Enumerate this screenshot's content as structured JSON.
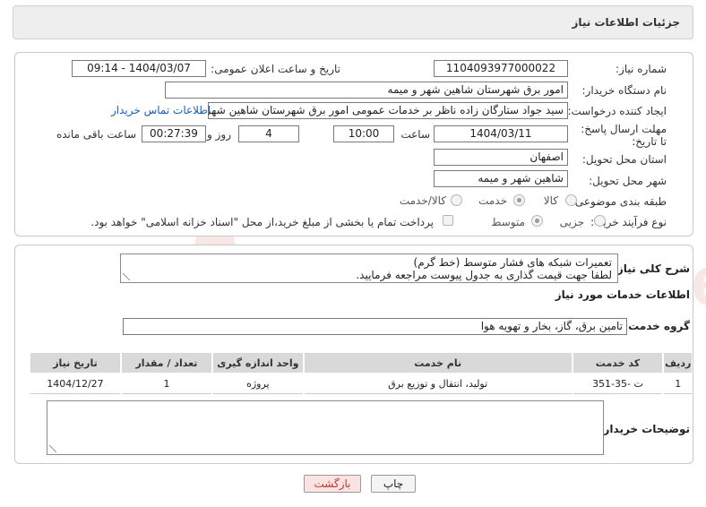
{
  "header": {
    "title": "جزئیات اطلاعات نیاز"
  },
  "fields": {
    "need_number_label": "شماره نیاز:",
    "need_number": "1104093977000022",
    "announce_label": "تاریخ و ساعت اعلان عمومی:",
    "announce_value": "1404/03/07 - 09:14",
    "buyer_org_label": "نام دستگاه خریدار:",
    "buyer_org": "امور برق شهرستان شاهین شهر و میمه",
    "creator_label": "ایجاد کننده درخواست:",
    "creator": "سید جواد ستارگان زاده ناظر بر خدمات عمومی امور برق شهرستان شاهین شهر",
    "contact_link": "اطلاعات تماس خریدار",
    "deadline_label": "مهلت ارسال پاسخ: تا تاریخ:",
    "deadline_date": "1404/03/11",
    "hour_label": "ساعت",
    "deadline_time": "10:00",
    "days_value": "4",
    "days_label": "روز و",
    "remaining_value": "00:27:39",
    "remaining_label": "ساعت باقی مانده",
    "province_label": "استان محل تحویل:",
    "province": "اصفهان",
    "city_label": "شهر محل تحویل:",
    "city": "شاهین شهر و میمه",
    "category_label": "طبقه بندی موضوعی:",
    "category_options": [
      "کالا",
      "خدمت",
      "کالا/خدمت"
    ],
    "category_selected": "خدمت",
    "process_label": "نوع فرآیند خرید :",
    "process_options": [
      "جزیی",
      "متوسط"
    ],
    "process_selected": "متوسط",
    "payment_note": "پرداخت تمام یا بخشی از مبلغ خرید،از محل \"اسناد خزانه اسلامی\" خواهد بود."
  },
  "description": {
    "label": "شرح کلی نیاز:",
    "line1": "تعمیرات شبکه های فشار متوسط (خط گرم)",
    "line2": "لطفا جهت قیمت گذاری به جدول پیوست مراجعه فرمایید."
  },
  "services": {
    "section_title": "اطلاعات خدمات مورد نیاز",
    "group_label": "گروه خدمت:",
    "group_value": "تامین برق، گاز، بخار و تهویه هوا",
    "columns": [
      "ردیف",
      "کد خدمت",
      "نام خدمت",
      "واحد اندازه گیری",
      "تعداد / مقدار",
      "تاریخ نیاز"
    ],
    "rows": [
      [
        "1",
        "ت -35-351",
        "تولید، انتقال و توزیع برق",
        "پروژه",
        "1",
        "1404/12/27"
      ]
    ]
  },
  "buyer_notes": {
    "label": "توضیحات خریدار:",
    "value": ""
  },
  "buttons": {
    "print": "چاپ",
    "back": "بازگشت"
  },
  "watermark": {
    "text": "AriaTender.neT"
  },
  "colors": {
    "link": "#1a5fb4",
    "back_button_bg": "#fbe3e3",
    "back_button_text": "#c0392b",
    "header_bg": "#eeeeee"
  }
}
